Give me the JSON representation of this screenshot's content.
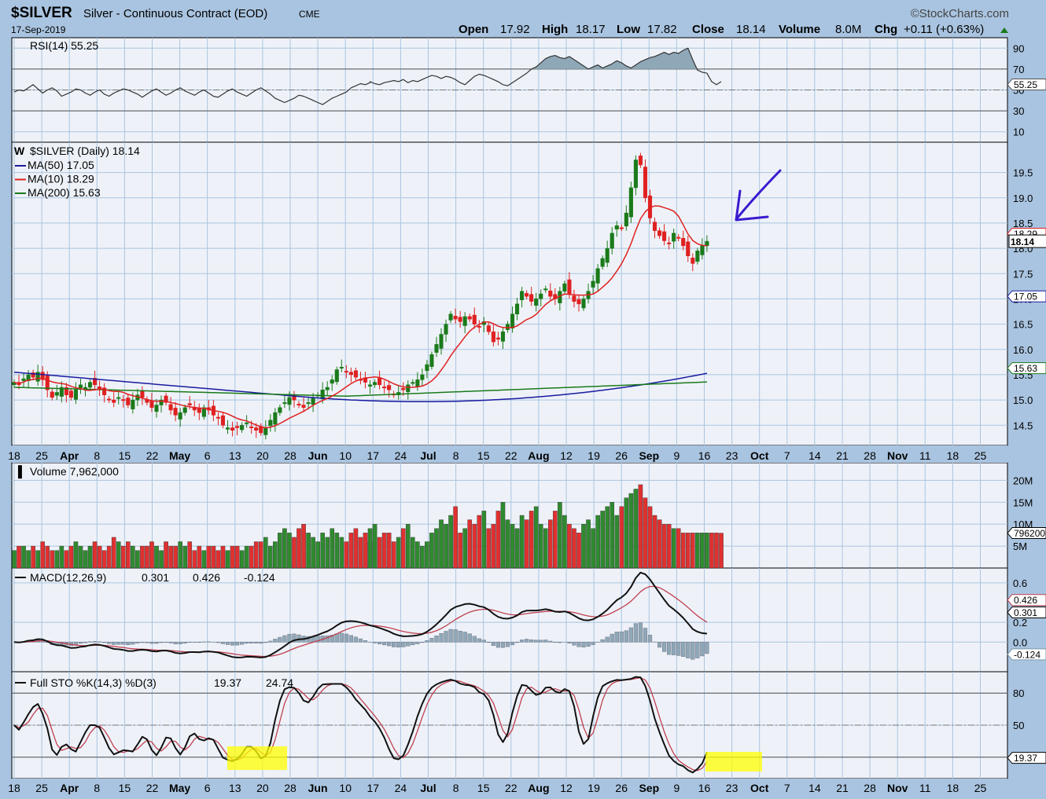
{
  "header": {
    "symbol": "$SILVER",
    "description": "Silver - Continuous Contract (EOD)",
    "exchange": "CME",
    "date": "17-Sep-2019",
    "brand": "©StockCharts.com",
    "open_label": "Open",
    "open": "17.92",
    "high_label": "High",
    "high": "18.17",
    "low_label": "Low",
    "low": "17.82",
    "close_label": "Close",
    "close": "18.14",
    "volume_label": "Volume",
    "volume": "8.0M",
    "chg_label": "Chg",
    "chg": "+0.11 (+0.63%)"
  },
  "colors": {
    "up": "#1a7a1a",
    "down": "#e02020",
    "ma50": "#1a1aa0",
    "ma10": "#e02020",
    "ma200": "#1a7a1a",
    "signal": "#c04050",
    "hist": "#8fa8b8",
    "grid": "#a9c4e0",
    "panel": "#eef2f8",
    "annotation": "#3a1ad0",
    "highlight": "#ffff00"
  },
  "date_axis": [
    {
      "label": "18",
      "month": false
    },
    {
      "label": "25",
      "month": false
    },
    {
      "label": "Apr",
      "month": true
    },
    {
      "label": "8",
      "month": false
    },
    {
      "label": "15",
      "month": false
    },
    {
      "label": "22",
      "month": false
    },
    {
      "label": "May",
      "month": true
    },
    {
      "label": "6",
      "month": false
    },
    {
      "label": "13",
      "month": false
    },
    {
      "label": "20",
      "month": false
    },
    {
      "label": "28",
      "month": false
    },
    {
      "label": "Jun",
      "month": true
    },
    {
      "label": "10",
      "month": false
    },
    {
      "label": "17",
      "month": false
    },
    {
      "label": "24",
      "month": false
    },
    {
      "label": "Jul",
      "month": true
    },
    {
      "label": "8",
      "month": false
    },
    {
      "label": "15",
      "month": false
    },
    {
      "label": "22",
      "month": false
    },
    {
      "label": "Aug",
      "month": true
    },
    {
      "label": "12",
      "month": false
    },
    {
      "label": "19",
      "month": false
    },
    {
      "label": "26",
      "month": false
    },
    {
      "label": "Sep",
      "month": true
    },
    {
      "label": "9",
      "month": false
    },
    {
      "label": "16",
      "month": false
    },
    {
      "label": "23",
      "month": false
    },
    {
      "label": "Oct",
      "month": true
    },
    {
      "label": "7",
      "month": false
    },
    {
      "label": "14",
      "month": false
    },
    {
      "label": "21",
      "month": false
    },
    {
      "label": "28",
      "month": false
    },
    {
      "label": "Nov",
      "month": true
    },
    {
      "label": "11",
      "month": false
    },
    {
      "label": "18",
      "month": false
    },
    {
      "label": "25",
      "month": false
    }
  ],
  "chart_data": [
    {
      "type": "line",
      "panel": "rsi",
      "legend": "RSI(14) 55.25",
      "ylim": [
        0,
        100
      ],
      "ticks": [
        "90",
        "70",
        "50",
        "30",
        "10"
      ],
      "tick_values": [
        90,
        70,
        50,
        30,
        10
      ],
      "current": "55.25",
      "current_value": 55.25,
      "reference_lines": [
        70,
        30
      ],
      "dashed_line": 50,
      "values": [
        48,
        50,
        49,
        52,
        55,
        51,
        47,
        50,
        52,
        49,
        44,
        46,
        48,
        51,
        50,
        47,
        45,
        48,
        50,
        46,
        44,
        47,
        49,
        51,
        50,
        48,
        46,
        43,
        46,
        49,
        51,
        48,
        45,
        47,
        50,
        52,
        49,
        47,
        45,
        48,
        50,
        47,
        44,
        43,
        46,
        49,
        51,
        48,
        46,
        44,
        47,
        50,
        52,
        49,
        46,
        42,
        40,
        38,
        40,
        42,
        45,
        44,
        42,
        40,
        38,
        36,
        39,
        42,
        44,
        46,
        48,
        52,
        54,
        56,
        55,
        57,
        58,
        56,
        55,
        57,
        58,
        59,
        58,
        60,
        57,
        59,
        58,
        60,
        62,
        64,
        63,
        61,
        63,
        62,
        60,
        57,
        55,
        59,
        63,
        65,
        64,
        62,
        60,
        58,
        55,
        54,
        57,
        60,
        63,
        66,
        70,
        72,
        76,
        80,
        82,
        83,
        81,
        80,
        82,
        79,
        76,
        73,
        70,
        72,
        74,
        71,
        73,
        75,
        78,
        76,
        73,
        71,
        74,
        77,
        79,
        81,
        82,
        84,
        86,
        84,
        86,
        85,
        88,
        90,
        79,
        69,
        67,
        66,
        58,
        55,
        58
      ],
      "values_note_skip": ""
    },
    {
      "type": "candlestick",
      "panel": "price",
      "legend": "$SILVER (Daily) 18.14",
      "ylim": [
        14.1,
        20.1
      ],
      "ticks": [
        "19.5",
        "19.0",
        "18.5",
        "18.0",
        "17.5",
        "17.0",
        "16.5",
        "16.0",
        "15.5",
        "15.0",
        "14.5"
      ],
      "tick_values": [
        19.5,
        19.0,
        18.5,
        18.0,
        17.5,
        17.0,
        16.5,
        16.0,
        15.5,
        15.0,
        14.5
      ],
      "series": [
        {
          "name": "MA(50) 17.05",
          "current": "17.05",
          "current_value": 17.05
        },
        {
          "name": "MA(10) 18.29",
          "current": "18.29",
          "current_value": 18.29
        },
        {
          "name": "MA(200) 15.63",
          "current": "15.63",
          "current_value": 15.63
        }
      ],
      "last_close": "18.14",
      "last_close_value": 18.14,
      "close": [
        15.35,
        15.3,
        15.42,
        15.5,
        15.45,
        15.55,
        15.4,
        15.2,
        15.05,
        15.15,
        15.25,
        15.1,
        15.05,
        15.2,
        15.3,
        15.25,
        15.35,
        15.3,
        15.2,
        15.1,
        15.0,
        14.95,
        15.05,
        15.0,
        14.9,
        15.0,
        15.1,
        15.05,
        14.95,
        14.85,
        14.9,
        15.0,
        14.95,
        14.8,
        14.7,
        14.75,
        14.85,
        14.9,
        14.8,
        14.75,
        14.85,
        14.8,
        14.7,
        14.65,
        14.5,
        14.45,
        14.4,
        14.45,
        14.5,
        14.55,
        14.45,
        14.4,
        14.35,
        14.45,
        14.6,
        14.75,
        14.85,
        14.95,
        15.05,
        15.0,
        14.9,
        14.85,
        14.95,
        15.05,
        15.1,
        15.2,
        15.25,
        15.4,
        15.6,
        15.65,
        15.55,
        15.5,
        15.45,
        15.4,
        15.35,
        15.3,
        15.35,
        15.3,
        15.25,
        15.2,
        15.1,
        15.15,
        15.2,
        15.3,
        15.35,
        15.4,
        15.5,
        15.7,
        15.9,
        16.1,
        16.3,
        16.5,
        16.7,
        16.6,
        16.55,
        16.65,
        16.6,
        16.5,
        16.45,
        16.55,
        16.35,
        16.15,
        16.2,
        16.35,
        16.5,
        16.7,
        16.9,
        17.15,
        17.05,
        16.95,
        17.0,
        17.1,
        17.2,
        17.05,
        17.0,
        17.15,
        17.3,
        17.1,
        16.95,
        16.9,
        17.0,
        17.15,
        17.35,
        17.6,
        17.8,
        18.0,
        18.3,
        18.45,
        18.4,
        18.7,
        19.2,
        19.75,
        19.65,
        19.0,
        18.6,
        18.35,
        18.25,
        18.15,
        18.1,
        18.3,
        18.2,
        18.05,
        17.85,
        17.7,
        17.95,
        18.05,
        18.14
      ],
      "hilo": 0.12
    },
    {
      "type": "bar",
      "panel": "volume",
      "legend": "Volume 7,962,000",
      "ylim": [
        0,
        24
      ],
      "ticks": [
        "20M",
        "15M",
        "10M",
        "5M"
      ],
      "tick_values": [
        20,
        15,
        10,
        5
      ],
      "current": "7962000",
      "current_value": 7.96,
      "values": [
        4,
        5,
        5,
        4,
        5,
        4,
        6,
        5,
        4,
        4,
        5,
        4,
        5,
        6,
        5,
        4,
        5,
        6,
        5,
        4,
        5,
        7,
        6,
        5,
        6,
        5,
        4,
        5,
        5,
        6,
        5,
        4,
        6,
        5,
        5,
        6,
        5,
        6,
        4,
        5,
        4,
        5,
        5,
        4,
        5,
        4,
        5,
        5,
        4,
        5,
        5,
        6,
        6,
        7,
        5,
        6,
        8,
        9,
        8,
        7,
        9,
        10,
        8,
        7,
        6,
        8,
        7,
        9,
        8,
        7,
        6,
        8,
        9,
        7,
        8,
        6,
        9,
        10,
        7,
        8,
        8,
        6,
        7,
        9,
        10,
        7,
        6,
        5,
        6,
        8,
        9,
        11,
        10,
        12,
        14,
        8,
        9,
        11,
        10,
        12,
        13,
        9,
        10,
        13,
        15,
        11,
        10,
        9,
        12,
        11,
        13,
        14,
        10,
        9,
        11,
        13,
        15,
        12,
        10,
        9,
        8,
        10,
        11,
        9,
        12,
        13,
        14,
        15,
        12,
        14,
        16,
        17,
        18,
        19,
        16,
        14,
        12,
        11,
        10,
        10,
        9,
        9,
        8,
        8,
        8,
        8,
        8,
        8,
        8,
        8,
        7.96
      ]
    },
    {
      "type": "line",
      "panel": "macd",
      "legend": "MACD(12,26,9)",
      "legend_macd": "0.301",
      "legend_signal": "0.426",
      "legend_hist": "-0.124",
      "ylim": [
        -0.3,
        0.75
      ],
      "ticks": [
        "0.6",
        "0.2",
        "0.0"
      ],
      "tick_values": [
        0.6,
        0.2,
        0.0
      ],
      "series": [
        {
          "current": "0.426",
          "current_value": 0.426
        },
        {
          "current": "0.301",
          "current_value": 0.301
        },
        {
          "current": "-0.124",
          "current_value": -0.124
        }
      ]
    },
    {
      "type": "line",
      "panel": "sto",
      "legend": "Full STO %K(14,3) %D(3)",
      "legend_k": "19.37",
      "legend_d": "24.74",
      "ylim": [
        0,
        100
      ],
      "ticks": [
        "80",
        "50",
        "20"
      ],
      "tick_values": [
        80,
        50,
        20
      ],
      "current": "19.37",
      "current_value": 19.37,
      "reference_lines": [
        80,
        20
      ],
      "dashed_line": 50
    }
  ]
}
